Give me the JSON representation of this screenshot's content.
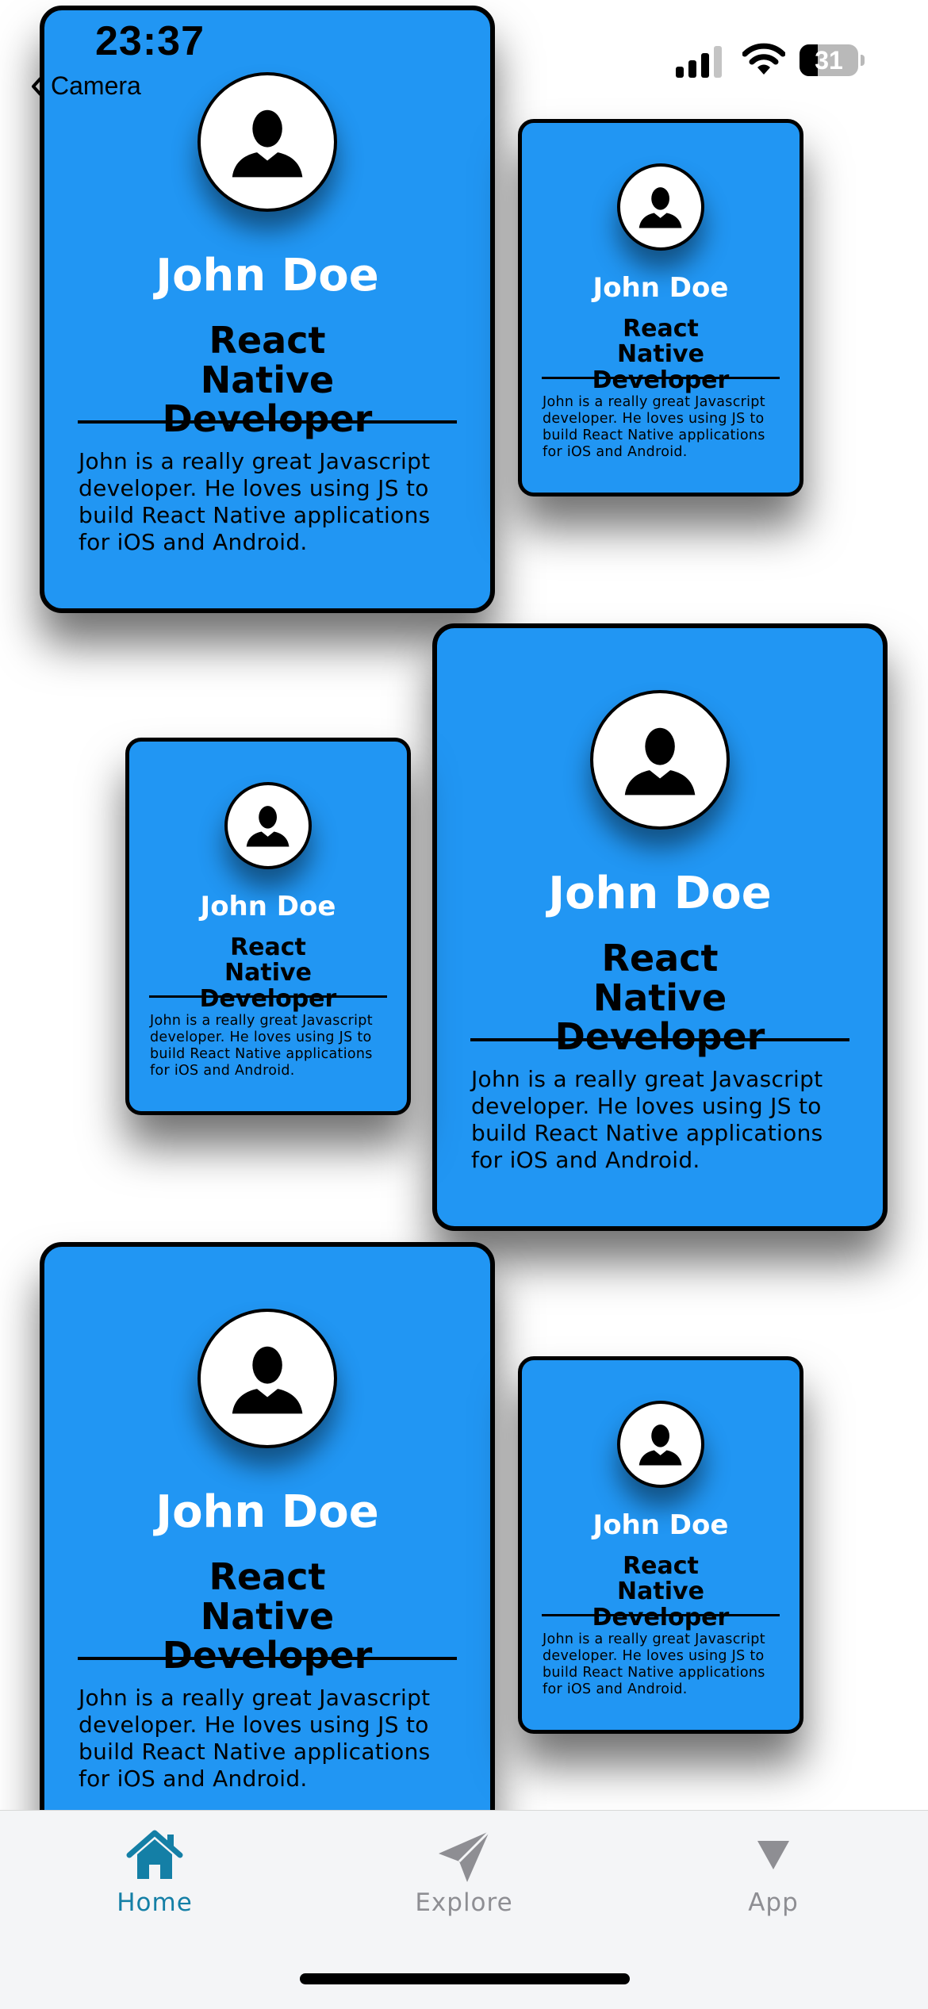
{
  "status_bar": {
    "time": "23:37",
    "back_label": "Camera",
    "battery_level": "31",
    "battery_fraction": 0.31
  },
  "cards": [
    {
      "name": "John Doe",
      "title": "React Native Developer",
      "bio": "John is a really great Javascript developer. He loves using JS to build React Native applications for iOS and Android."
    },
    {
      "name": "John Doe",
      "title": "React Native Developer",
      "bio": "John is a really great Javascript developer. He loves using JS to build React Native applications for iOS and Android."
    },
    {
      "name": "John Doe",
      "title": "React Native Developer",
      "bio": "John is a really great Javascript developer. He loves using JS to build React Native applications for iOS and Android."
    },
    {
      "name": "John Doe",
      "title": "React Native Developer",
      "bio": "John is a really great Javascript developer. He loves using JS to build React Native applications for iOS and Android."
    },
    {
      "name": "John Doe",
      "title": "React Native Developer",
      "bio": "John is a really great Javascript developer. He loves using JS to build React Native applications for iOS and Android."
    },
    {
      "name": "John Doe",
      "title": "React Native Developer",
      "bio": "John is a really great Javascript developer. He loves using JS to build React Native applications for iOS and Android."
    }
  ],
  "tab_bar": {
    "tabs": [
      {
        "label": "Home",
        "icon": "home-icon",
        "active": true
      },
      {
        "label": "Explore",
        "icon": "send-icon",
        "active": false
      },
      {
        "label": "App",
        "icon": "triangle-down-icon",
        "active": false
      }
    ]
  },
  "colors": {
    "card_background": "#2196f3",
    "card_border": "#000000",
    "active_tab": "#147fa6",
    "inactive_tab": "#8e8e93",
    "tab_bar_background": "#f4f5f7"
  }
}
